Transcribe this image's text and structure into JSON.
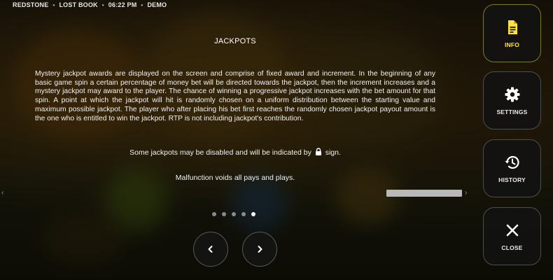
{
  "status_bar": {
    "game": "REDSTONE",
    "title": "LOST BOOK",
    "time": "06:22 PM",
    "mode": "DEMO",
    "separator": "•"
  },
  "page": {
    "title": "JACKPOTS",
    "body": "Mystery jackpot awards are displayed on the screen and comprise of fixed award and increment. In the beginning of any basic game spin a certain percentage of money bet will be directed towards the jackpot, then the increment increases and a mystery jackpot may award to the player. The chance of winning a progressive jackpot increases with the bet amount for that spin. A point at which the jackpot will hit is randomly chosen on a uniform distribution between the starting value and maximum possible jackpot. The player who after placing his bet first reaches the randomly chosen jackpot payout amount is the one who is entitled to win the jackpot. RTP is not including jackpot's contribution.",
    "lock_note_before": "Some jackpots may be disabled and will be indicated by",
    "lock_note_after": "sign.",
    "lock_icon": "lock-icon",
    "malfunction": "Malfunction voids all pays and plays."
  },
  "pagination": {
    "total": 5,
    "current": 5
  },
  "navigation": {
    "prev_icon": "chevron-left-icon",
    "next_icon": "chevron-right-icon"
  },
  "side_menu": {
    "items": [
      {
        "label": "INFO",
        "icon": "document-icon",
        "active": true
      },
      {
        "label": "SETTINGS",
        "icon": "gear-icon",
        "active": false
      },
      {
        "label": "HISTORY",
        "icon": "history-icon",
        "active": false
      },
      {
        "label": "CLOSE",
        "icon": "close-icon",
        "active": false
      }
    ]
  },
  "colors": {
    "accent": "#ffe33a",
    "text": "#ffffff",
    "panel": "#121212"
  }
}
